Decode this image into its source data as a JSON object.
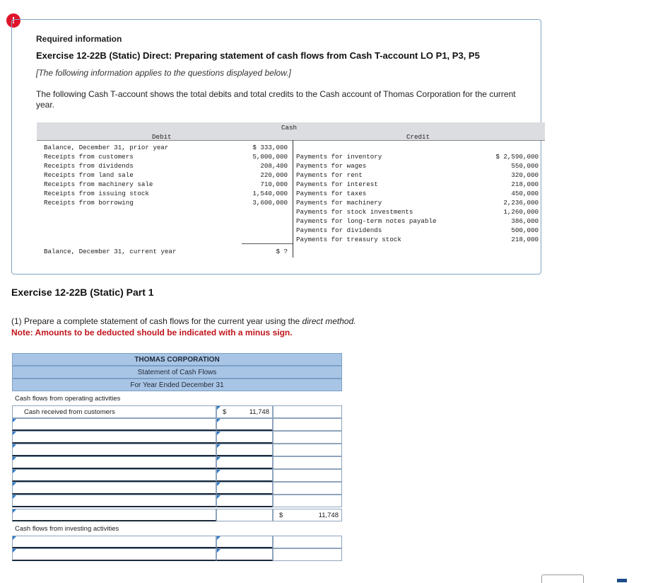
{
  "alert_symbol": "!",
  "header": {
    "required": "Required information",
    "exercise_title": "Exercise 12-22B (Static) Direct: Preparing statement of cash flows from Cash T-account LO P1, P3, P5",
    "applies_note": "[The following information applies to the questions displayed below.]",
    "intro": "The following Cash T-account shows the total debits and total credits to the Cash account of Thomas Corporation for the current year."
  },
  "t_account": {
    "title": "Cash",
    "debit_header": "Debit",
    "credit_header": "Credit",
    "debits": [
      {
        "label": "Balance, December 31, prior year",
        "amount": "$ 333,000"
      },
      {
        "label": "Receipts from customers",
        "amount": "5,000,000"
      },
      {
        "label": "Receipts from dividends",
        "amount": "208,400"
      },
      {
        "label": "Receipts from land sale",
        "amount": "220,000"
      },
      {
        "label": "Receipts from machinery sale",
        "amount": "710,000"
      },
      {
        "label": "Receipts from issuing stock",
        "amount": "1,540,000"
      },
      {
        "label": "Receipts from borrowing",
        "amount": "3,600,000"
      }
    ],
    "credits": [
      {
        "label": "Payments for inventory",
        "amount": "$ 2,590,000"
      },
      {
        "label": "Payments for wages",
        "amount": "550,000"
      },
      {
        "label": "Payments for rent",
        "amount": "320,000"
      },
      {
        "label": "Payments for interest",
        "amount": "218,000"
      },
      {
        "label": "Payments for taxes",
        "amount": "450,000"
      },
      {
        "label": "Payments for machinery",
        "amount": "2,236,000"
      },
      {
        "label": "Payments for stock investments",
        "amount": "1,260,000"
      },
      {
        "label": "Payments for long-term notes payable",
        "amount": "386,000"
      },
      {
        "label": "Payments for dividends",
        "amount": "500,000"
      },
      {
        "label": "Payments for treasury stock",
        "amount": "218,000"
      }
    ],
    "ending_label": "Balance, December 31, current year",
    "ending_amount": "$ ?"
  },
  "part": {
    "title": "Exercise 12-22B (Static) Part 1",
    "instruction_prefix": "(1) Prepare a complete statement of cash flows for the current year using the ",
    "instruction_italic": "direct method.",
    "note": "Note: Amounts to be deducted should be indicated with a minus sign."
  },
  "statement": {
    "company": "THOMAS CORPORATION",
    "title": "Statement of Cash Flows",
    "period": "For Year Ended December 31",
    "operating_heading": "Cash flows from operating activities",
    "customers_label": "Cash received from customers",
    "customers_dollar": "$",
    "customers_amount": "11,748",
    "operating_total_dollar": "$",
    "operating_total": "11,748",
    "investing_heading": "Cash flows from investing activities"
  }
}
